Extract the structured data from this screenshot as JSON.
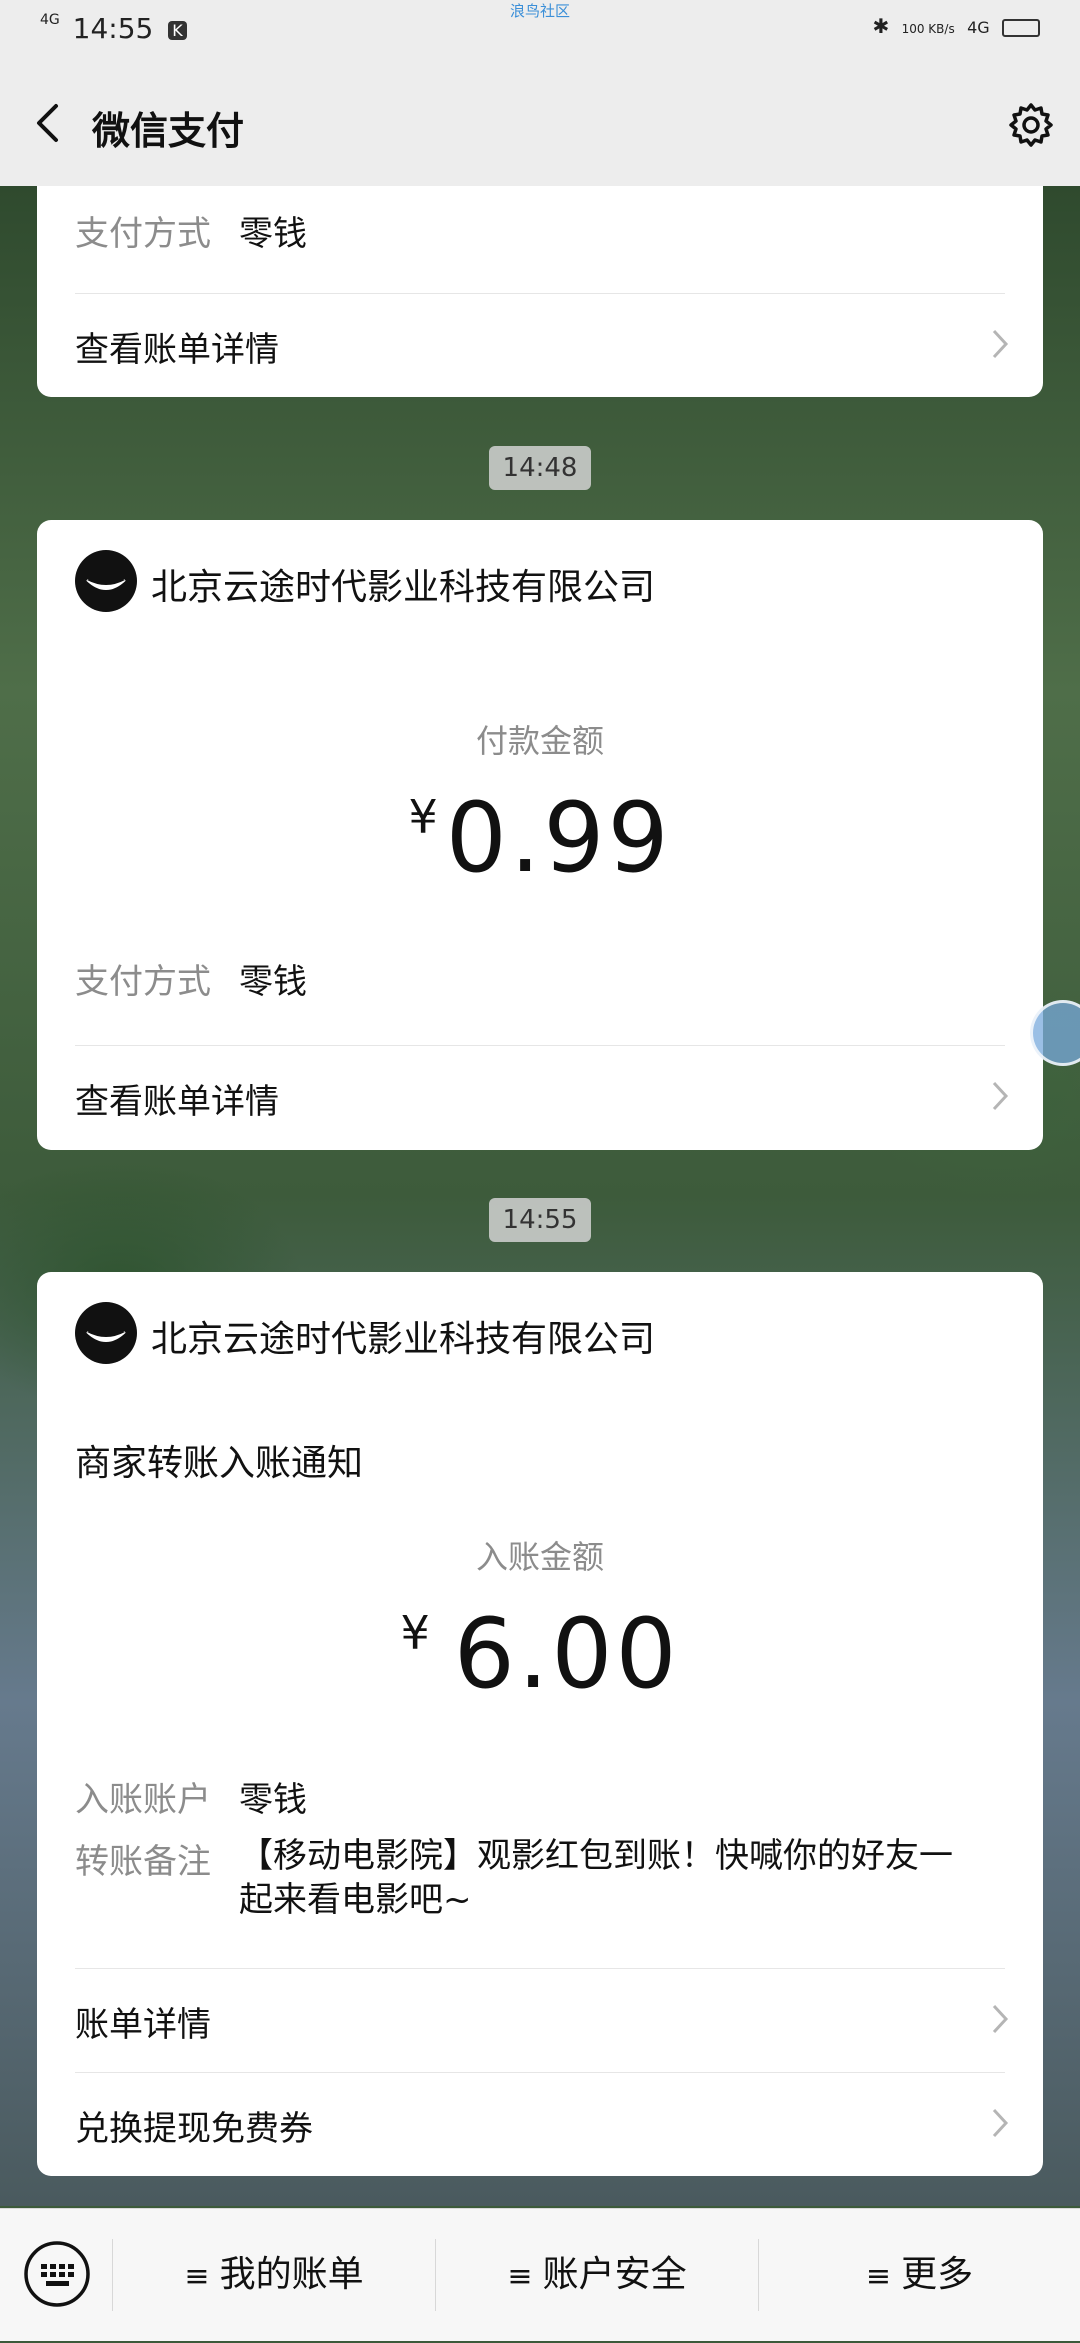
{
  "status_bar": {
    "network_left": "4G",
    "time": "14:55",
    "center_label": "浪鸟社区",
    "speed": "100 KB/s",
    "network_right": "4G"
  },
  "nav": {
    "title": "微信支付"
  },
  "card1": {
    "method_label": "支付方式",
    "method_value": "零钱",
    "detail_link": "查看账单详情"
  },
  "time1": "14:48",
  "card2": {
    "merchant": "北京云途时代影业科技有限公司",
    "amount_label": "付款金额",
    "currency": "¥",
    "amount": "0.99",
    "method_label": "支付方式",
    "method_value": "零钱",
    "detail_link": "查看账单详情"
  },
  "time2": "14:55",
  "card3": {
    "merchant": "北京云途时代影业科技有限公司",
    "notice_title": "商家转账入账通知",
    "amount_label": "入账金额",
    "currency": "¥",
    "amount": "6.00",
    "account_label": "入账账户",
    "account_value": "零钱",
    "note_label": "转账备注",
    "note_value_line1": "【移动电影院】观影红包到账！快喊你的好友一",
    "note_value_line2": "起来看电影吧~",
    "detail_link": "账单详情",
    "voucher_link": "兑换提现免费券"
  },
  "bottom_bar": {
    "items": [
      {
        "label": "我的账单"
      },
      {
        "label": "账户安全"
      },
      {
        "label": "更多"
      }
    ],
    "menu_glyph": "≡"
  }
}
